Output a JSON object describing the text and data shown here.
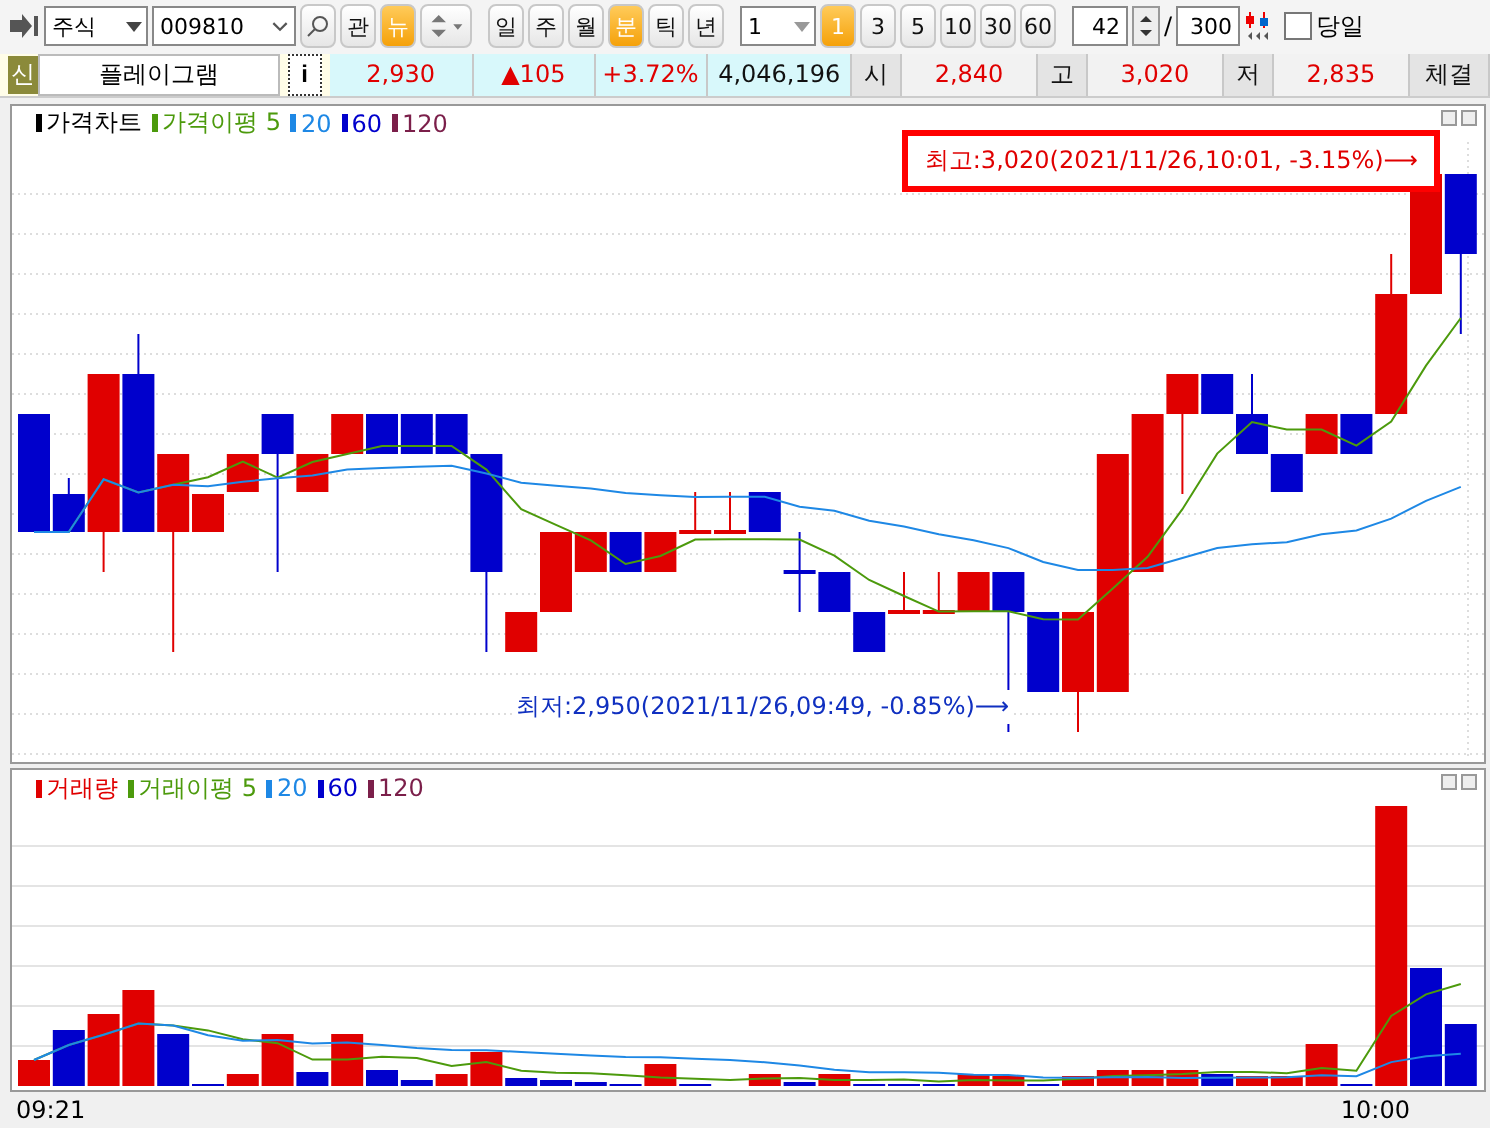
{
  "toolbar": {
    "market": "주식",
    "code": "009810",
    "buttons": [
      {
        "label": "관",
        "selected": false
      },
      {
        "label": "뉴",
        "selected": true
      }
    ],
    "periods": [
      {
        "label": "일",
        "selected": false
      },
      {
        "label": "주",
        "selected": false
      },
      {
        "label": "월",
        "selected": false
      },
      {
        "label": "분",
        "selected": true
      },
      {
        "label": "틱",
        "selected": false
      },
      {
        "label": "년",
        "selected": false
      }
    ],
    "interval_select": "1",
    "intervals": [
      {
        "label": "1",
        "selected": true
      },
      {
        "label": "3",
        "selected": false
      },
      {
        "label": "5",
        "selected": false
      },
      {
        "label": "10",
        "selected": false
      },
      {
        "label": "30",
        "selected": false
      },
      {
        "label": "60",
        "selected": false
      }
    ],
    "count": "42",
    "separator": "/",
    "total": "300",
    "today": {
      "label": "당일",
      "checked": false
    }
  },
  "info_bar": {
    "badge": "신",
    "name": "플레이그램",
    "info_button": "i",
    "price": "2,930",
    "change": "▲105",
    "change_pct": "+3.72%",
    "volume": "4,046,196",
    "fields": [
      {
        "label": "시",
        "value": "2,840"
      },
      {
        "label": "고",
        "value": "3,020"
      },
      {
        "label": "저",
        "value": "2,835"
      }
    ],
    "trailing": "체결"
  },
  "price_panel": {
    "legend": [
      {
        "label": "가격차트",
        "color": "#000000"
      },
      {
        "label": "가격이평 5",
        "color": "#4c9a0c"
      },
      {
        "label": "20",
        "color": "#1e88e5"
      },
      {
        "label": "60",
        "color": "#0000cc"
      },
      {
        "label": "120",
        "color": "#7b1f4a"
      }
    ],
    "high_label": "최고:3,020(2021/11/26,10:01, -3.15%)⟶",
    "low_label": "최저:2,950(2021/11/26,09:49, -0.85%)⟶"
  },
  "volume_panel": {
    "legend": [
      {
        "label": "거래량",
        "color": "#e00000"
      },
      {
        "label": "거래이평 5",
        "color": "#4c9a0c"
      },
      {
        "label": "20",
        "color": "#1e88e5"
      },
      {
        "label": "60",
        "color": "#0000cc"
      },
      {
        "label": "120",
        "color": "#7b1f4a"
      }
    ]
  },
  "time_axis": [
    "09:21",
    "10:00"
  ]
}
